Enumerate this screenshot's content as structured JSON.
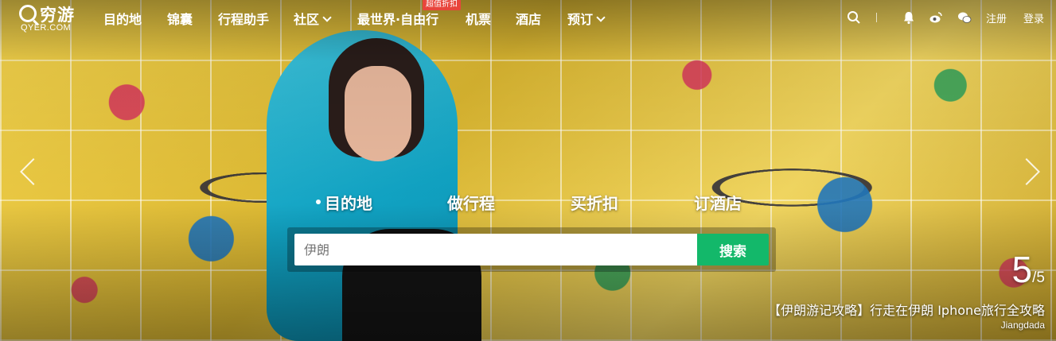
{
  "logo": {
    "name": "穷游",
    "domain": "QYER.COM"
  },
  "nav": {
    "items": [
      {
        "label": "目的地",
        "dropdown": false
      },
      {
        "label": "锦囊",
        "dropdown": false
      },
      {
        "label": "行程助手",
        "dropdown": false
      },
      {
        "label": "社区",
        "dropdown": true
      },
      {
        "label": "最世界·自由行",
        "dropdown": false,
        "badge": "超值折扣"
      },
      {
        "label": "机票",
        "dropdown": false
      },
      {
        "label": "酒店",
        "dropdown": false
      },
      {
        "label": "预订",
        "dropdown": true
      }
    ]
  },
  "header_right": {
    "icons": [
      "search-icon",
      "notification-bell-icon",
      "weibo-icon",
      "wechat-icon"
    ],
    "register": "注册",
    "login": "登录"
  },
  "search": {
    "tabs": [
      {
        "label": "目的地",
        "active": true
      },
      {
        "label": "做行程",
        "active": false
      },
      {
        "label": "买折扣",
        "active": false
      },
      {
        "label": "订酒店",
        "active": false
      }
    ],
    "placeholder": "伊朗",
    "button": "搜索"
  },
  "slide": {
    "current": "5",
    "total": "/5",
    "caption": "【伊朗游记攻略】行走在伊朗 Iphone旅行全攻略",
    "author": "Jiangdada"
  },
  "colors": {
    "accent": "#13b86a",
    "badge": "#e8453c",
    "scarf": "#11a2c2"
  }
}
